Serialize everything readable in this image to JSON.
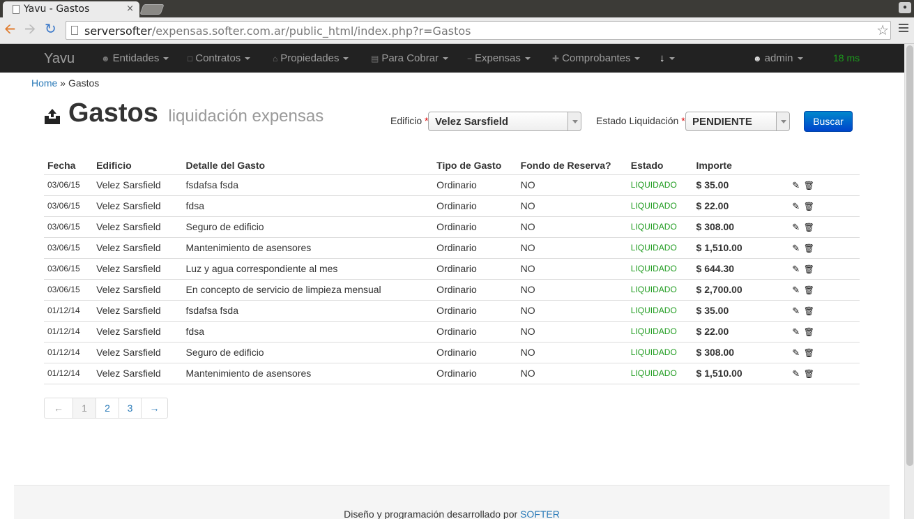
{
  "browser": {
    "tab_title": "Yavu - Gastos",
    "tab_close": "×",
    "url_host": "serversofter",
    "url_path": "/expensas.softer.com.ar/public_html/index.php?r=Gastos"
  },
  "navbar": {
    "brand": "Yavu",
    "items": [
      {
        "label": "Entidades",
        "icon": "user-icon"
      },
      {
        "label": "Contratos",
        "icon": "file-icon"
      },
      {
        "label": "Propiedades",
        "icon": "home-icon"
      },
      {
        "label": "Para Cobrar",
        "icon": "list-icon"
      },
      {
        "label": "Expensas",
        "icon": "minus-icon"
      },
      {
        "label": "Comprobantes",
        "icon": "plus-icon"
      }
    ],
    "download_icon": "arrow-down-icon",
    "user": "admin",
    "timer": "18 ms"
  },
  "breadcrumb": {
    "home": "Home",
    "sep": " » ",
    "current": "Gastos"
  },
  "header": {
    "title": "Gastos",
    "subtitle": "liquidación expensas"
  },
  "filters": {
    "edificio_label": "Edificio",
    "edificio_value": "Velez Sarsfield",
    "estado_label": "Estado Liquidación",
    "estado_value": "PENDIENTE",
    "required_mark": "*",
    "search_button": "Buscar"
  },
  "table": {
    "headers": [
      "Fecha",
      "Edificio",
      "Detalle del Gasto",
      "Tipo de Gasto",
      "Fondo de Reserva?",
      "Estado",
      "Importe"
    ],
    "rows": [
      {
        "fecha": "03/06/15",
        "edificio": "Velez Sarsfield",
        "detalle": "fsdafsa fsda",
        "tipo": "Ordinario",
        "fondo": "NO",
        "estado": "LIQUIDADO",
        "importe": "$ 35.00"
      },
      {
        "fecha": "03/06/15",
        "edificio": "Velez Sarsfield",
        "detalle": "fdsa",
        "tipo": "Ordinario",
        "fondo": "NO",
        "estado": "LIQUIDADO",
        "importe": "$ 22.00"
      },
      {
        "fecha": "03/06/15",
        "edificio": "Velez Sarsfield",
        "detalle": "Seguro de edificio",
        "tipo": "Ordinario",
        "fondo": "NO",
        "estado": "LIQUIDADO",
        "importe": "$ 308.00"
      },
      {
        "fecha": "03/06/15",
        "edificio": "Velez Sarsfield",
        "detalle": "Mantenimiento de asensores",
        "tipo": "Ordinario",
        "fondo": "NO",
        "estado": "LIQUIDADO",
        "importe": "$ 1,510.00"
      },
      {
        "fecha": "03/06/15",
        "edificio": "Velez Sarsfield",
        "detalle": "Luz y agua correspondiente al mes",
        "tipo": "Ordinario",
        "fondo": "NO",
        "estado": "LIQUIDADO",
        "importe": "$ 644.30"
      },
      {
        "fecha": "03/06/15",
        "edificio": "Velez Sarsfield",
        "detalle": "En concepto de servicio de limpieza mensual",
        "tipo": "Ordinario",
        "fondo": "NO",
        "estado": "LIQUIDADO",
        "importe": "$ 2,700.00"
      },
      {
        "fecha": "01/12/14",
        "edificio": "Velez Sarsfield",
        "detalle": "fsdafsa fsda",
        "tipo": "Ordinario",
        "fondo": "NO",
        "estado": "LIQUIDADO",
        "importe": "$ 35.00"
      },
      {
        "fecha": "01/12/14",
        "edificio": "Velez Sarsfield",
        "detalle": "fdsa",
        "tipo": "Ordinario",
        "fondo": "NO",
        "estado": "LIQUIDADO",
        "importe": "$ 22.00"
      },
      {
        "fecha": "01/12/14",
        "edificio": "Velez Sarsfield",
        "detalle": "Seguro de edificio",
        "tipo": "Ordinario",
        "fondo": "NO",
        "estado": "LIQUIDADO",
        "importe": "$ 308.00"
      },
      {
        "fecha": "01/12/14",
        "edificio": "Velez Sarsfield",
        "detalle": "Mantenimiento de asensores",
        "tipo": "Ordinario",
        "fondo": "NO",
        "estado": "LIQUIDADO",
        "importe": "$ 1,510.00"
      }
    ]
  },
  "pagination": {
    "prev": "←",
    "pages": [
      "1",
      "2",
      "3"
    ],
    "next": "→",
    "active": "1"
  },
  "footer": {
    "text": "Diseño y programación desarrollado por ",
    "link": "SOFTER"
  },
  "colors": {
    "navbar_bg": "#222222",
    "link": "#2a7ab8",
    "status_ok": "#1c9a1c",
    "primary_button": "#0055cc"
  }
}
